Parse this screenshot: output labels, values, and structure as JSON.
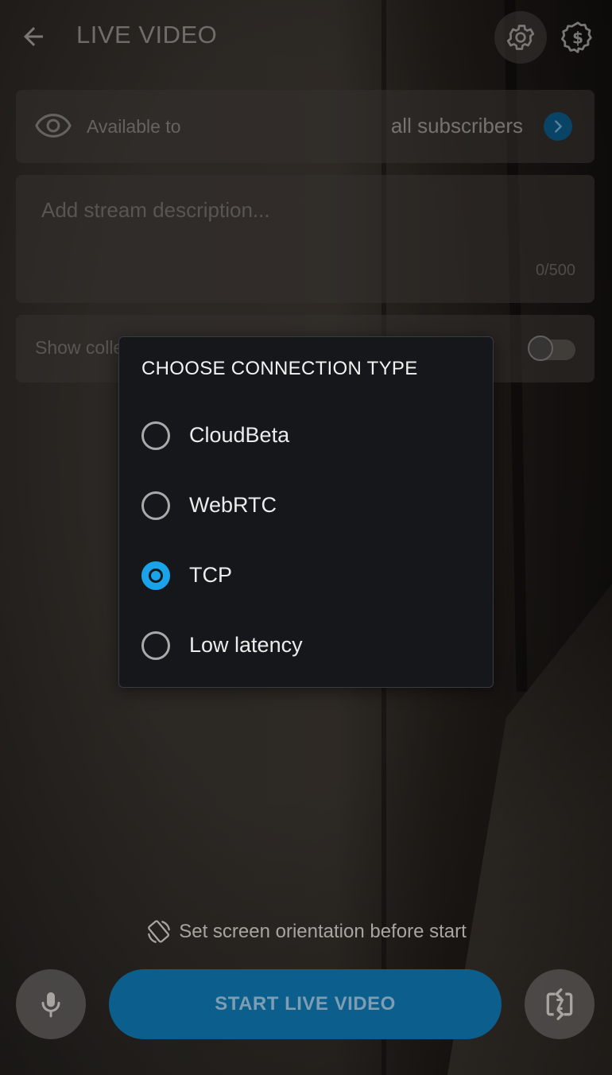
{
  "header": {
    "title": "LIVE VIDEO",
    "back_icon": "arrow-left-icon",
    "settings_icon": "gear-icon",
    "monetization_icon": "dollar-badge-icon"
  },
  "availability": {
    "label": "Available to",
    "value": "all subscribers",
    "icon": "eye-icon"
  },
  "description": {
    "placeholder": "Add stream description...",
    "value": "",
    "counter": "0/500"
  },
  "tips": {
    "label": "Show collected tips to viewers",
    "enabled": false
  },
  "dialog": {
    "title": "CHOOSE CONNECTION TYPE",
    "options": [
      {
        "label": "CloudBeta",
        "selected": false
      },
      {
        "label": "WebRTC",
        "selected": false
      },
      {
        "label": "TCP",
        "selected": true
      },
      {
        "label": "Low latency",
        "selected": false
      }
    ]
  },
  "footer": {
    "orientation_hint": "Set screen orientation before start",
    "start_label": "START LIVE VIDEO",
    "mic_icon": "microphone-icon",
    "flip_icon": "camera-flip-icon"
  },
  "colors": {
    "accent": "#1aa3e8",
    "primary_button": "#0c5e8d",
    "dialog_bg": "#16171a"
  }
}
